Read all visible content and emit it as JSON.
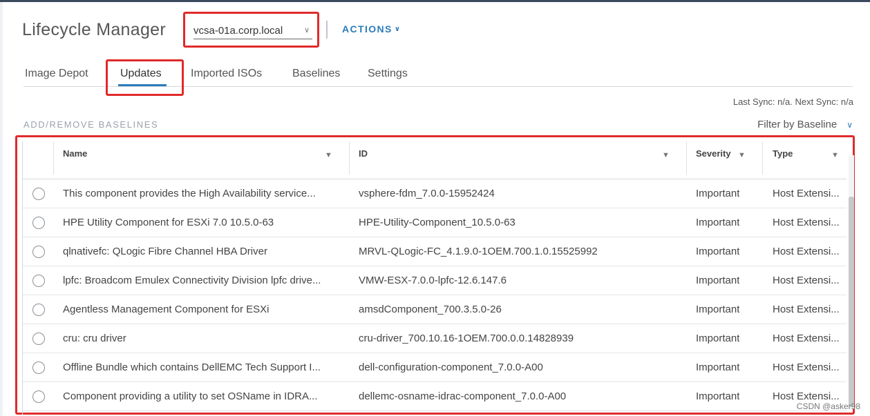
{
  "header": {
    "title": "Lifecycle Manager",
    "vcenter_select": "vcsa-01a.corp.local",
    "actions_label": "ACTIONS"
  },
  "tabs": [
    {
      "label": "Image Depot",
      "active": false
    },
    {
      "label": "Updates",
      "active": true
    },
    {
      "label": "Imported ISOs",
      "active": false
    },
    {
      "label": "Baselines",
      "active": false
    },
    {
      "label": "Settings",
      "active": false
    }
  ],
  "sync_status": "Last Sync: n/a. Next Sync: n/a",
  "section_title": "ADD/REMOVE BASELINES",
  "filter": {
    "label": "Filter by Baseline"
  },
  "table": {
    "columns": [
      "Name",
      "ID",
      "Severity",
      "Type"
    ],
    "rows": [
      {
        "name": "This component provides the High Availability service...",
        "id": "vsphere-fdm_7.0.0-15952424",
        "severity": "Important",
        "type": "Host Extensi..."
      },
      {
        "name": "HPE Utility Component for ESXi 7.0 10.5.0-63",
        "id": "HPE-Utility-Component_10.5.0-63",
        "severity": "Important",
        "type": "Host Extensi..."
      },
      {
        "name": "qlnativefc: QLogic Fibre Channel HBA Driver",
        "id": "MRVL-QLogic-FC_4.1.9.0-1OEM.700.1.0.15525992",
        "severity": "Important",
        "type": "Host Extensi..."
      },
      {
        "name": "lpfc: Broadcom Emulex Connectivity Division lpfc drive...",
        "id": "VMW-ESX-7.0.0-lpfc-12.6.147.6",
        "severity": "Important",
        "type": "Host Extensi..."
      },
      {
        "name": "Agentless Management Component for ESXi",
        "id": "amsdComponent_700.3.5.0-26",
        "severity": "Important",
        "type": "Host Extensi..."
      },
      {
        "name": "cru: cru driver",
        "id": "cru-driver_700.10.16-1OEM.700.0.0.14828939",
        "severity": "Important",
        "type": "Host Extensi..."
      },
      {
        "name": "Offline Bundle which contains DellEMC Tech Support I...",
        "id": "dell-configuration-component_7.0.0-A00",
        "severity": "Important",
        "type": "Host Extensi..."
      },
      {
        "name": "Component providing a utility to set OSName in IDRA...",
        "id": "dellemc-osname-idrac-component_7.0.0-A00",
        "severity": "Important",
        "type": "Host Extensi..."
      }
    ]
  },
  "watermark": "CSDN @asker98",
  "colors": {
    "accent": "#2a7cbb",
    "highlight_box": "#e02a2a"
  }
}
